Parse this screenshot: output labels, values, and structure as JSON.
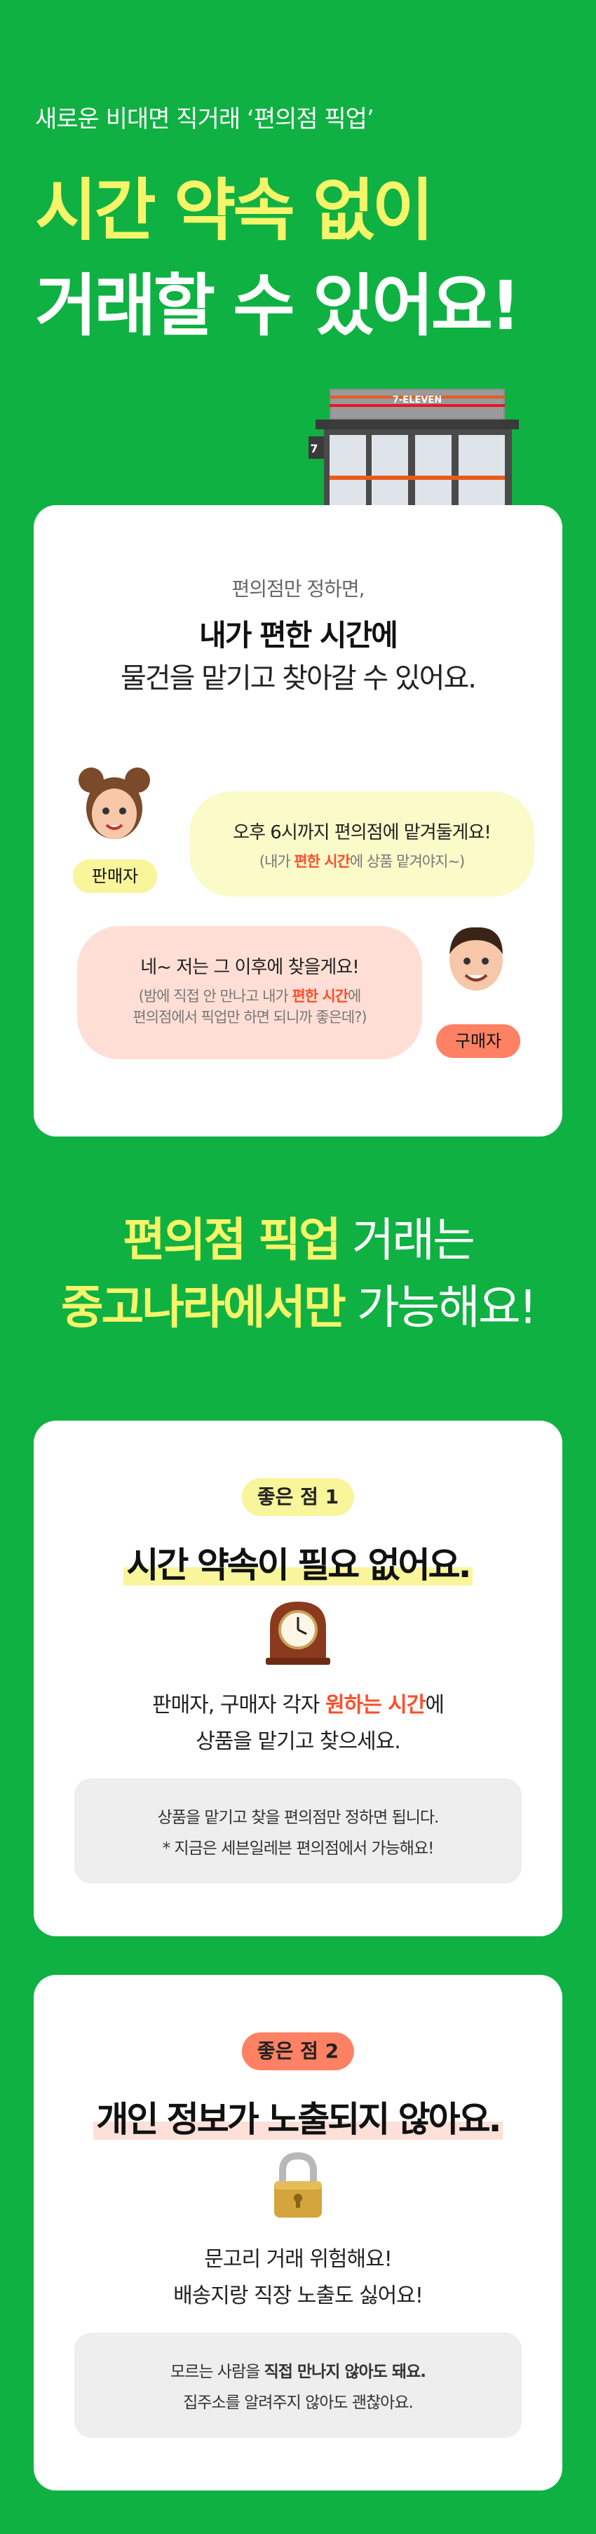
{
  "header": {
    "subtitle": "새로운 비대면 직거래 ‘편의점 픽업’",
    "headline_line1": "시간 약속 없이",
    "headline_line2": "거래할 수 있어요!"
  },
  "store": {
    "sign": "7-ELEVEN",
    "side_logo": "7"
  },
  "intro_card": {
    "small": "편의점만 정하면,",
    "big": "내가 편한 시간에",
    "line": "물건을 맡기고 찾아갈 수 있어요.",
    "seller_tag": "판매자",
    "buyer_tag": "구매자",
    "seller_main": "오후 6시까지 편의점에 맡겨둘게요!",
    "seller_sub_pre": "(내가 ",
    "seller_sub_hl": "편한 시간",
    "seller_sub_post": "에 상품 맡겨야지~)",
    "buyer_main": "네~ 저는 그 이후에 찾을게요!",
    "buyer_sub1_pre": "(밤에 직접 안 만나고 내가 ",
    "buyer_sub1_hl": "편한 시간",
    "buyer_sub1_post": "에",
    "buyer_sub2": "편의점에서 픽업만 하면 되니까 좋은데?)"
  },
  "section": {
    "line1_hl": "편의점 픽업",
    "line1_rest": " 거래는",
    "line2_hl": "중고나라에서만",
    "line2_rest": " 가능해요!"
  },
  "benefit1": {
    "pill": "좋은 점 1",
    "title": "시간 약속이 필요 없어요.",
    "icon": "clock-icon",
    "desc1_pre": "판매자, 구매자 각자 ",
    "desc1_hl": "원하는 시간",
    "desc1_post": "에",
    "desc2": "상품을 맡기고 찾으세요.",
    "note1": "상품을 맡기고 찾을 편의점만 정하면 됩니다.",
    "note2": "* 지금은 세븐일레븐 편의점에서 가능해요!"
  },
  "benefit2": {
    "pill": "좋은 점 2",
    "title": "개인 정보가 노출되지 않아요.",
    "icon": "lock-icon",
    "desc1": "문고리 거래 위험해요!",
    "desc2": "배송지랑 직장 노출도 싫어요!",
    "note1_pre": "모르는 사람을 ",
    "note1_bold": "직접 만나지 않아도 돼요.",
    "note2": "집주소를 알려주지 않아도 괜찮아요."
  },
  "colors": {
    "background": "#0fb142",
    "accent_yellow": "#f6f56a",
    "accent_orange": "#ff4d2a",
    "pill_yellow": "#f8f59a",
    "pill_orange": "#ff8163"
  }
}
